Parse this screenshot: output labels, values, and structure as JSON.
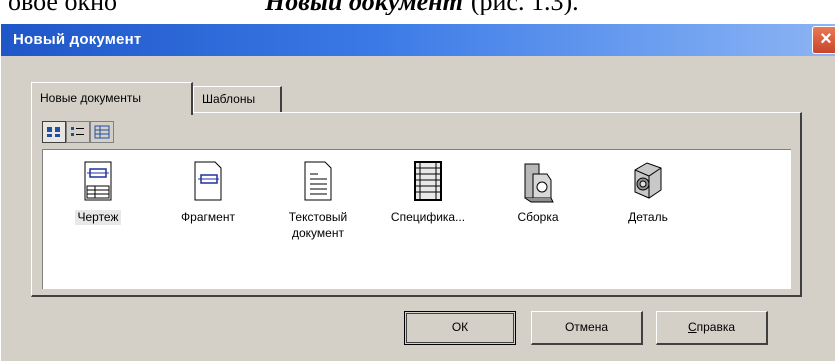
{
  "caption": {
    "pre": "овое окно",
    "emphasis": "Новый документ",
    "post": "(рис. 1.3)."
  },
  "window": {
    "title": "Новый документ",
    "close_glyph": "×"
  },
  "tabs": [
    {
      "label": "Новые документы",
      "active": true
    },
    {
      "label": "Шаблоны",
      "active": false
    }
  ],
  "view_buttons": [
    {
      "icon": "large-icons-view-icon",
      "pressed": true
    },
    {
      "icon": "small-icons-view-icon",
      "pressed": false
    },
    {
      "icon": "details-view-icon",
      "pressed": false
    }
  ],
  "documents": [
    {
      "label_line1": "Чертеж",
      "label_line2": "",
      "icon": "drawing-icon",
      "selected": true
    },
    {
      "label_line1": "Фрагмент",
      "label_line2": "",
      "icon": "fragment-icon",
      "selected": false
    },
    {
      "label_line1": "Текстовый",
      "label_line2": "документ",
      "icon": "text-document-icon",
      "selected": false
    },
    {
      "label_line1": "Специфика...",
      "label_line2": "",
      "icon": "specification-icon",
      "selected": false
    },
    {
      "label_line1": "Сборка",
      "label_line2": "",
      "icon": "assembly-icon",
      "selected": false
    },
    {
      "label_line1": "Деталь",
      "label_line2": "",
      "icon": "part-icon",
      "selected": false
    }
  ],
  "buttons": {
    "ok": "ОК",
    "cancel": "Отмена",
    "help_first": "С",
    "help_rest": "правка"
  },
  "colors": {
    "titlebar_start": "#1f56c8",
    "titlebar_end": "#8db4f4",
    "dialog_face": "#d4d0c8",
    "close_button": "#c8452a"
  }
}
